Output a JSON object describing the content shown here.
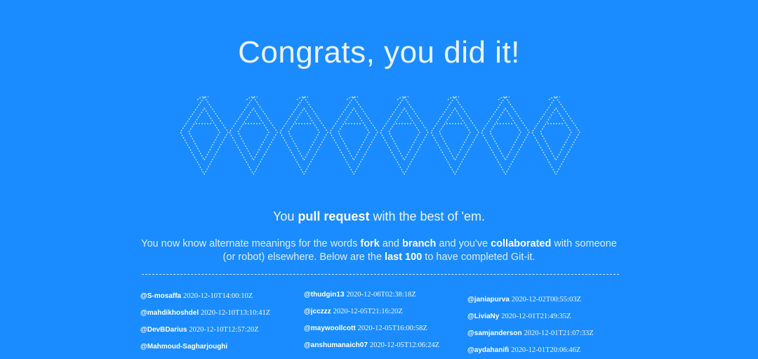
{
  "title": "Congrats, you did it!",
  "tagline": {
    "pre": "You ",
    "bold": "pull request",
    "post": " with the best of 'em."
  },
  "description": {
    "p1": "You now know alternate meanings for the words ",
    "b1": "fork",
    "p2": " and ",
    "b2": "branch",
    "p3": " and you've ",
    "b3": "collaborated",
    "p4": " with someone (or robot) elsewhere. Below are the ",
    "b4": "last 100",
    "p5": " to have completed Git-it."
  },
  "completions": [
    [
      {
        "user": "@S-mosaffa",
        "time": "2020-12-10T14:00:10Z"
      },
      {
        "user": "@mahdikhoshdel",
        "time": "2020-12-10T13:10:41Z"
      },
      {
        "user": "@DevBDarius",
        "time": "2020-12-10T12:57:20Z"
      },
      {
        "user": "@Mahmoud-Sagharjoughi",
        "time": ""
      }
    ],
    [
      {
        "user": "@thudgin13",
        "time": "2020-12-06T02:38:18Z"
      },
      {
        "user": "@jcczzz",
        "time": "2020-12-05T21:16:20Z"
      },
      {
        "user": "@maywoollcott",
        "time": "2020-12-05T16:00:58Z"
      },
      {
        "user": "@anshumanaich07",
        "time": "2020-12-05T12:06:24Z"
      }
    ],
    [
      {
        "user": "@janiapurva",
        "time": "2020-12-02T00:55:03Z"
      },
      {
        "user": "@LiviaNy",
        "time": "2020-12-01T21:49:35Z"
      },
      {
        "user": "@samjanderson",
        "time": "2020-12-01T21:07:33Z"
      },
      {
        "user": "@aydahanifi",
        "time": "2020-12-01T20:06:46Z"
      }
    ]
  ],
  "colors": {
    "background": "#1a8cff",
    "text": "#ffffff",
    "art": "#cfe6ff"
  },
  "art_icon": "octocat-ascii-art"
}
